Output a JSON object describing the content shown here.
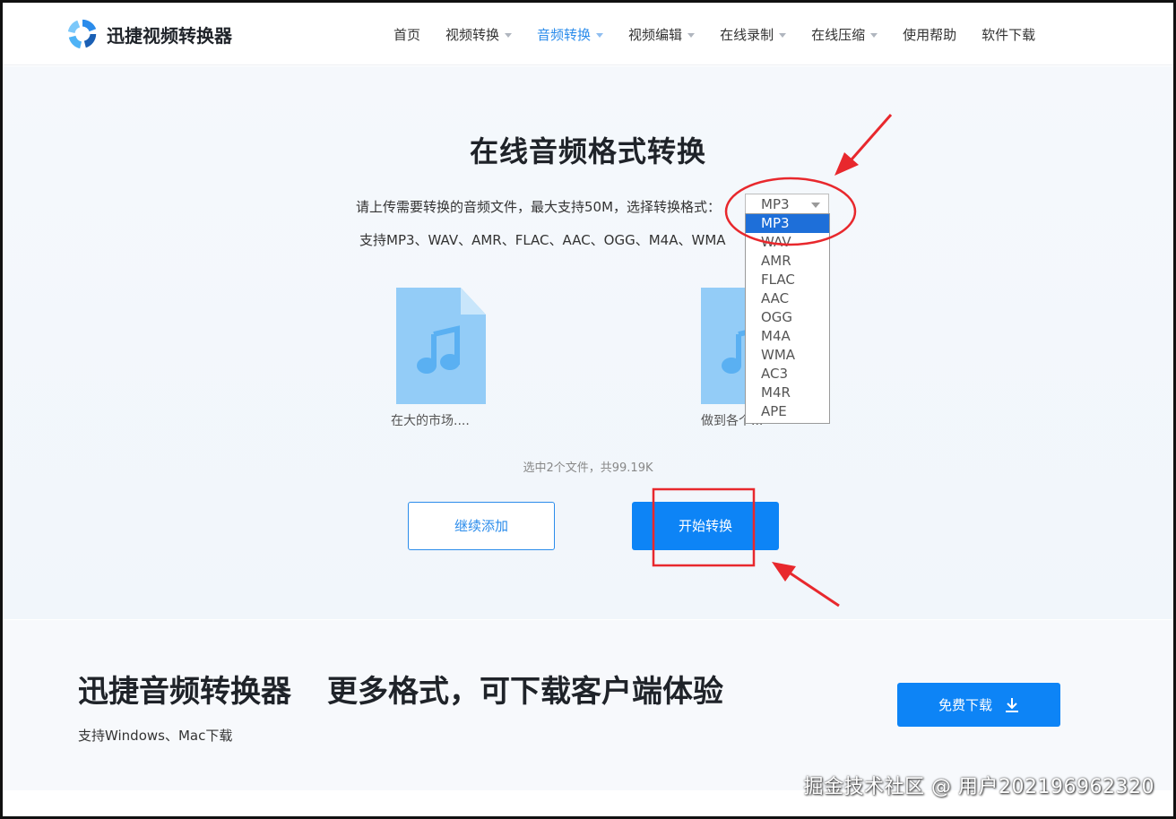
{
  "header": {
    "logo_text": "迅捷视频转换器",
    "nav": [
      {
        "label": "首页",
        "dropdown": false,
        "active": false
      },
      {
        "label": "视频转换",
        "dropdown": true,
        "active": false
      },
      {
        "label": "音频转换",
        "dropdown": true,
        "active": true
      },
      {
        "label": "视频编辑",
        "dropdown": true,
        "active": false
      },
      {
        "label": "在线录制",
        "dropdown": true,
        "active": false
      },
      {
        "label": "在线压缩",
        "dropdown": true,
        "active": false
      },
      {
        "label": "使用帮助",
        "dropdown": false,
        "active": false
      },
      {
        "label": "软件下载",
        "dropdown": false,
        "active": false
      }
    ]
  },
  "hero": {
    "title": "在线音频格式转换",
    "upload_hint": "请上传需要转换的音频文件，最大支持50M，选择转换格式：",
    "support_line": "支持MP3、WAV、AMR、FLAC、AAC、OGG、M4A、WMA",
    "format_select": {
      "value": "MP3",
      "options": [
        "MP3",
        "WAV",
        "AMR",
        "FLAC",
        "AAC",
        "OGG",
        "M4A",
        "WMA",
        "AC3",
        "M4R",
        "APE"
      ],
      "highlighted": "MP3"
    },
    "files": [
      {
        "name": "在大的市场...."
      },
      {
        "name": "做到各个..."
      }
    ],
    "summary": "选中2个文件，共99.19K",
    "add_button": "继续添加",
    "start_button": "开始转换"
  },
  "promo": {
    "title_left": "迅捷音频转换器",
    "title_right": "更多格式，可下载客户端体验",
    "subtitle": "支持Windows、Mac下载",
    "download_button": "免费下载"
  },
  "watermark": "掘金技术社区 @ 用户202196962320",
  "colors": {
    "accent": "#0d84f6",
    "nav_active": "#2b8ceb",
    "annotation": "#e8282d",
    "dropdown_selected": "#1e6fd9"
  }
}
